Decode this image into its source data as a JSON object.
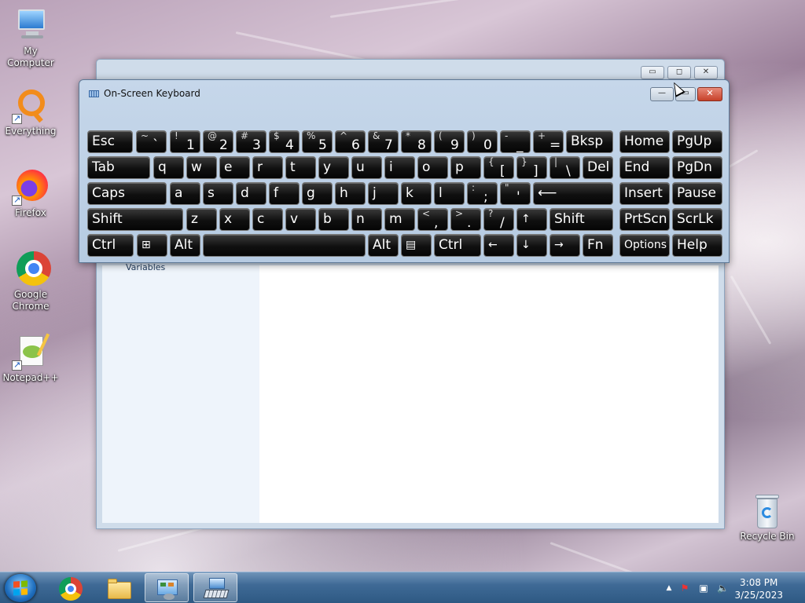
{
  "desktop": {
    "icons": [
      {
        "label": "My Computer"
      },
      {
        "label": "Everything"
      },
      {
        "label": "Firefox"
      },
      {
        "label": "Google Chrome"
      },
      {
        "label": "Notepad++"
      }
    ],
    "recycle_bin": "Recycle Bin"
  },
  "background_window": {
    "side_text": "Variables"
  },
  "osk": {
    "title": "On-Screen Keyboard",
    "minimize": "—",
    "maximize": "▭",
    "close": "✕",
    "rows": [
      [
        {
          "main": "Esc"
        },
        {
          "sh": "~",
          "lo": "`"
        },
        {
          "sh": "!",
          "lo": "1"
        },
        {
          "sh": "@",
          "lo": "2"
        },
        {
          "sh": "#",
          "lo": "3"
        },
        {
          "sh": "$",
          "lo": "4"
        },
        {
          "sh": "%",
          "lo": "5"
        },
        {
          "sh": "^",
          "lo": "6"
        },
        {
          "sh": "&",
          "lo": "7"
        },
        {
          "sh": "*",
          "lo": "8"
        },
        {
          "sh": "(",
          "lo": "9"
        },
        {
          "sh": ")",
          "lo": "0"
        },
        {
          "sh": "-",
          "lo": "_"
        },
        {
          "sh": "+",
          "lo": "="
        },
        {
          "main": "Bksp"
        },
        {
          "main": "Home"
        },
        {
          "main": "PgUp"
        }
      ],
      [
        {
          "main": "Tab"
        },
        {
          "main": "q"
        },
        {
          "main": "w"
        },
        {
          "main": "e"
        },
        {
          "main": "r"
        },
        {
          "main": "t"
        },
        {
          "main": "y"
        },
        {
          "main": "u"
        },
        {
          "main": "i"
        },
        {
          "main": "o"
        },
        {
          "main": "p"
        },
        {
          "sh": "{",
          "lo": "["
        },
        {
          "sh": "}",
          "lo": "]"
        },
        {
          "sh": "|",
          "lo": "\\"
        },
        {
          "main": "Del"
        },
        {
          "main": "End"
        },
        {
          "main": "PgDn"
        }
      ],
      [
        {
          "main": "Caps"
        },
        {
          "main": "a"
        },
        {
          "main": "s"
        },
        {
          "main": "d"
        },
        {
          "main": "f"
        },
        {
          "main": "g"
        },
        {
          "main": "h"
        },
        {
          "main": "j"
        },
        {
          "main": "k"
        },
        {
          "main": "l"
        },
        {
          "sh": ":",
          "lo": ";"
        },
        {
          "sh": "\"",
          "lo": "'"
        },
        {
          "main": "⟵"
        },
        {
          "main": "Insert"
        },
        {
          "main": "Pause"
        }
      ],
      [
        {
          "main": "Shift"
        },
        {
          "main": "z"
        },
        {
          "main": "x"
        },
        {
          "main": "c"
        },
        {
          "main": "v"
        },
        {
          "main": "b"
        },
        {
          "main": "n"
        },
        {
          "main": "m"
        },
        {
          "sh": "<",
          "lo": ","
        },
        {
          "sh": ">",
          "lo": "."
        },
        {
          "sh": "?",
          "lo": "/"
        },
        {
          "main": "↑"
        },
        {
          "main": "Shift"
        },
        {
          "main": "PrtScn"
        },
        {
          "main": "ScrLk"
        }
      ],
      [
        {
          "main": "Ctrl"
        },
        {
          "main": "⊞"
        },
        {
          "main": "Alt"
        },
        {
          "main": ""
        },
        {
          "main": "Alt"
        },
        {
          "main": "▤"
        },
        {
          "main": "Ctrl"
        },
        {
          "main": "←"
        },
        {
          "main": "↓"
        },
        {
          "main": "→"
        },
        {
          "main": "Fn"
        },
        {
          "main": "Options"
        },
        {
          "main": "Help"
        }
      ]
    ]
  },
  "taskbar": {
    "time": "3:08 PM",
    "date": "3/25/2023"
  }
}
